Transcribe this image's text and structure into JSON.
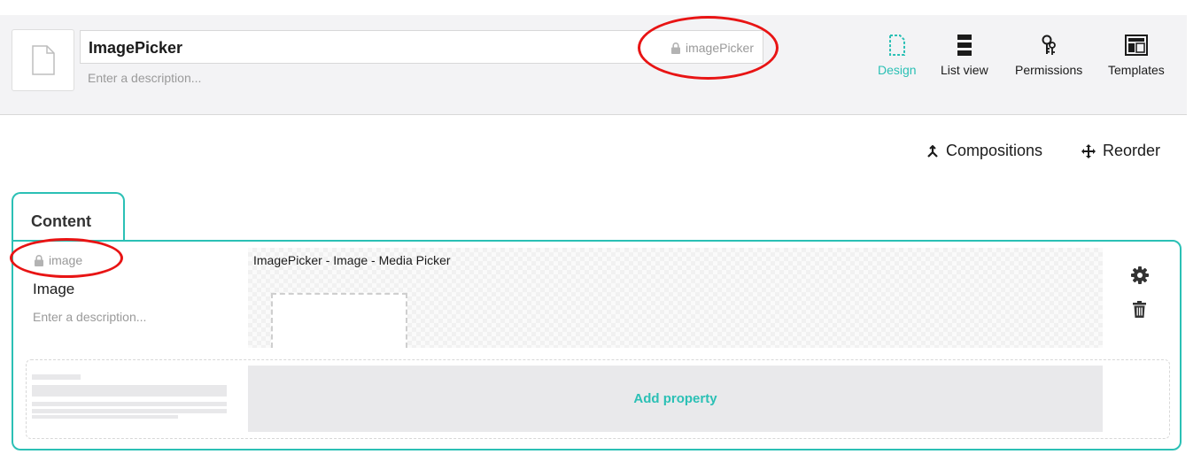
{
  "header": {
    "name_value": "ImagePicker",
    "alias": "imagePicker",
    "description_placeholder": "Enter a description..."
  },
  "nav": {
    "items": [
      {
        "label": "Design",
        "icon": "document-icon",
        "active": true
      },
      {
        "label": "List view",
        "icon": "list-icon",
        "active": false
      },
      {
        "label": "Permissions",
        "icon": "keys-icon",
        "active": false
      },
      {
        "label": "Templates",
        "icon": "layout-icon",
        "active": false
      }
    ]
  },
  "toolbar": {
    "compositions_label": "Compositions",
    "reorder_label": "Reorder"
  },
  "tabs": [
    {
      "label": "Content"
    }
  ],
  "property": {
    "alias": "image",
    "label": "Image",
    "description_placeholder": "Enter a description...",
    "editor_label": "ImagePicker - Image - Media Picker"
  },
  "add_property_label": "Add property",
  "colors": {
    "accent": "#2bc0b5",
    "annotation": "#e81414",
    "header_bg": "#f3f3f5"
  }
}
